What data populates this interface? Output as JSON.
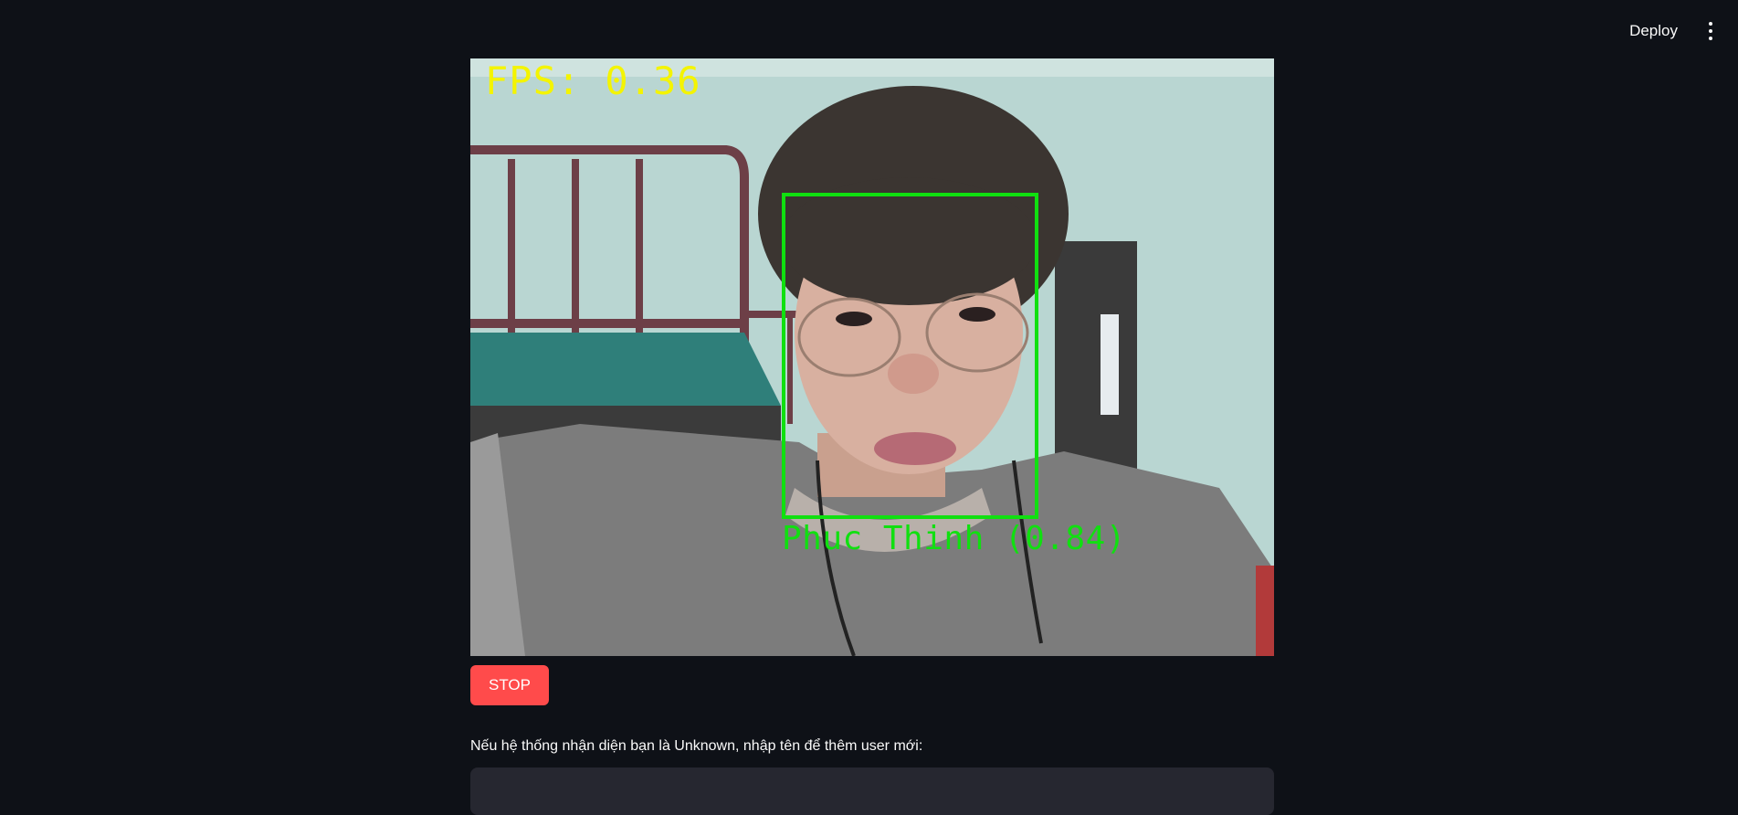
{
  "header": {
    "deploy_label": "Deploy",
    "menu_icon": "vertical-ellipsis-icon"
  },
  "video": {
    "fps_text": "FPS: 0.36",
    "detection_label": "Phuc Thinh (0.84)",
    "box_color": "#10e010",
    "fps_color": "#f4f400"
  },
  "controls": {
    "stop_label": "STOP",
    "stop_color": "#ff4b4b"
  },
  "new_user": {
    "prompt": "Nếu hệ thống nhận diện bạn là Unknown, nhập tên để thêm user mới:",
    "input_value": "",
    "input_placeholder": ""
  }
}
